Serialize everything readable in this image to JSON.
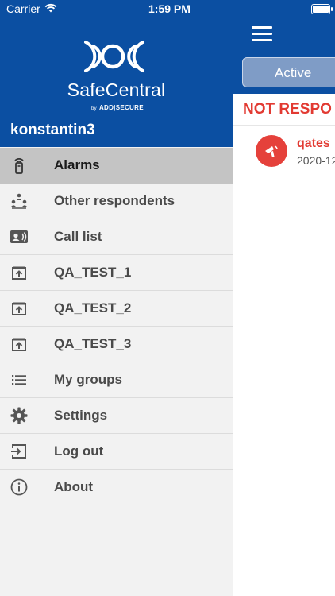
{
  "status_bar": {
    "carrier": "Carrier",
    "time": "1:59 PM"
  },
  "drawer": {
    "logo_text": "SafeCentral",
    "logo_by": "by",
    "logo_company": "ADD|SECURE",
    "username": "konstantin3",
    "items": [
      {
        "label": "Alarms",
        "icon": "alarm-transmitter-icon",
        "selected": true
      },
      {
        "label": "Other respondents",
        "icon": "respondents-icon"
      },
      {
        "label": "Call list",
        "icon": "contact-card-icon"
      },
      {
        "label": "QA_TEST_1",
        "icon": "tray-upload-icon"
      },
      {
        "label": "QA_TEST_2",
        "icon": "tray-upload-icon"
      },
      {
        "label": "QA_TEST_3",
        "icon": "tray-upload-icon"
      },
      {
        "label": "My groups",
        "icon": "list-icon"
      },
      {
        "label": "Settings",
        "icon": "gear-icon"
      },
      {
        "label": "Log out",
        "icon": "logout-icon"
      },
      {
        "label": "About",
        "icon": "info-icon"
      }
    ]
  },
  "main": {
    "tab_active": "Active",
    "section_title": "NOT RESPO",
    "alarm": {
      "name": "qates",
      "date": "2020-12"
    }
  },
  "colors": {
    "brand_blue": "#0b4fa2",
    "alert_red": "#e23a32"
  }
}
